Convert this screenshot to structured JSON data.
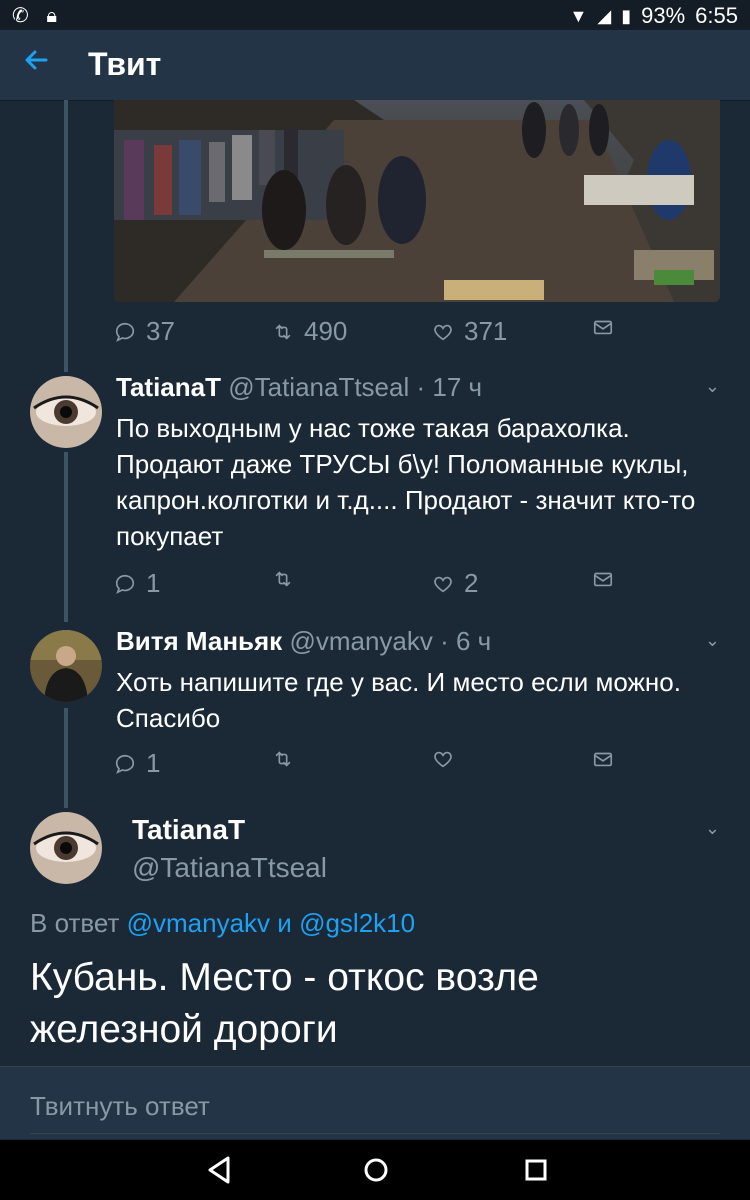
{
  "status_bar": {
    "battery": "93%",
    "time": "6:55"
  },
  "app_bar": {
    "title": "Твит"
  },
  "photo_tweet": {
    "actions": {
      "replies": "37",
      "retweets": "490",
      "likes": "371"
    }
  },
  "reply1": {
    "name": "TatianaT",
    "handle": "@TatianaTtseal",
    "time": "· 17 ч",
    "text": "По выходным у нас тоже такая барахолка. Продают даже ТРУСЫ б\\у! Поломанные куклы, капрон.колготки и т.д.... Продают - значит кто-то покупает",
    "actions": {
      "replies": "1",
      "retweets": "",
      "likes": "2"
    }
  },
  "reply2": {
    "name": "Витя Маньяк",
    "handle": "@vmanyakv",
    "time": "· 6 ч",
    "text": "Хоть напишите где у вас. И место если можно. Спасибо",
    "actions": {
      "replies": "1",
      "retweets": "",
      "likes": ""
    }
  },
  "main_tweet": {
    "name": "TatianaT",
    "handle": "@TatianaTtseal",
    "reply_prefix": "В ответ",
    "reply_user1": "@vmanyakv",
    "reply_and": "и",
    "reply_user2": "@gsl2k10",
    "text": "Кубань. Место - откос возле железной дороги"
  },
  "compose": {
    "placeholder": "Твитнуть ответ"
  },
  "colors": {
    "background": "#1b2836",
    "accent": "#1da1f2",
    "muted": "#8899a6"
  }
}
